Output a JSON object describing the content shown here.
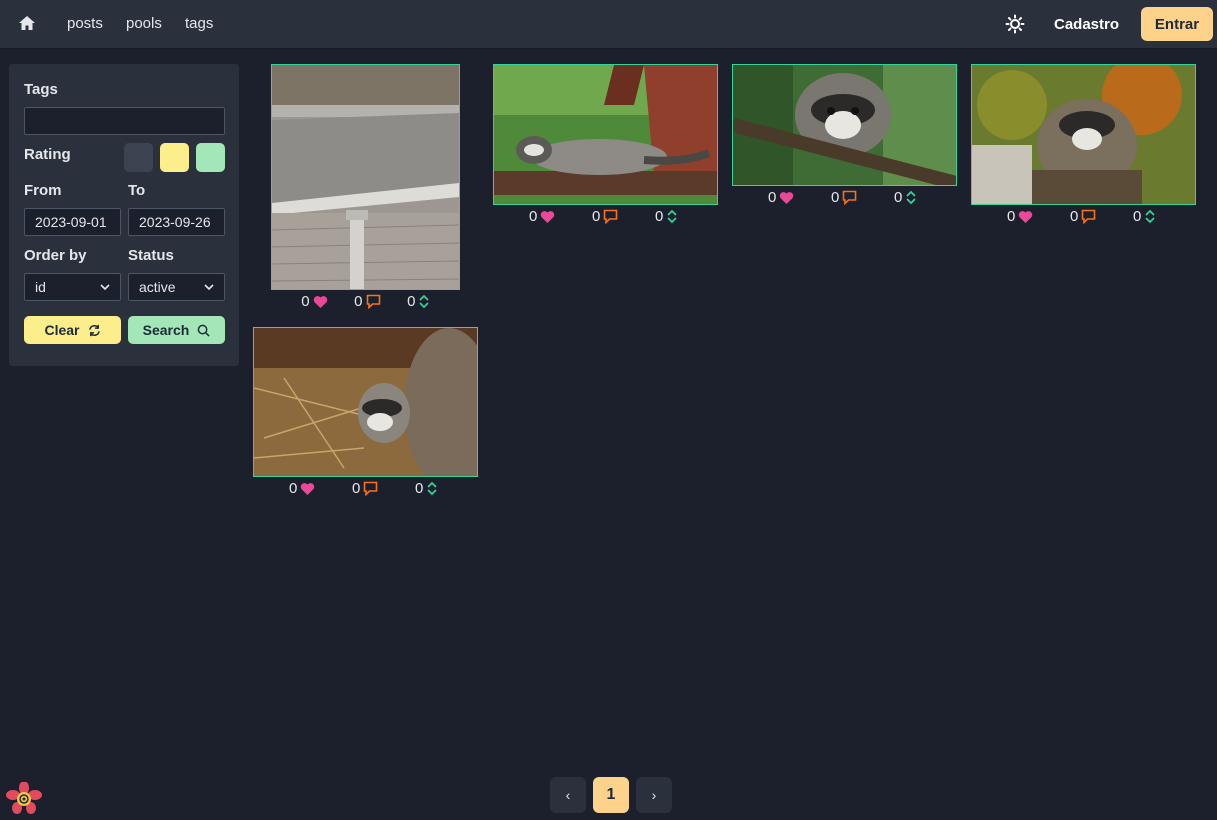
{
  "nav": {
    "home_icon": "home-icon",
    "links": [
      "posts",
      "pools",
      "tags"
    ],
    "theme_icon": "sun-icon",
    "signup_label": "Cadastro",
    "login_label": "Entrar"
  },
  "filters": {
    "tags_label": "Tags",
    "tags_value": "",
    "rating_label": "Rating",
    "rating_colors": [
      "#3d4451",
      "#fcef8b",
      "#a3e7b8"
    ],
    "from_label": "From",
    "to_label": "To",
    "from_value": "2023-09-01",
    "to_value": "2023-09-26",
    "order_label": "Order by",
    "order_value": "id",
    "status_label": "Status",
    "status_value": "active",
    "clear_label": "Clear",
    "clear_icon": "refresh-icon",
    "search_label": "Search",
    "search_icon": "search-icon"
  },
  "posts": [
    {
      "likes": "0",
      "comments": "0",
      "score": "0"
    },
    {
      "likes": "0",
      "comments": "0",
      "score": "0"
    },
    {
      "likes": "0",
      "comments": "0",
      "score": "0"
    },
    {
      "likes": "0",
      "comments": "0",
      "score": "0"
    },
    {
      "likes": "0",
      "comments": "0",
      "score": "0"
    }
  ],
  "pagination": {
    "prev": "‹",
    "current": "1",
    "next": "›"
  },
  "colors": {
    "accent": "#fdd28b",
    "like": "#ec4899",
    "comment": "#f97316",
    "score": "#36d399",
    "border": "#36d399"
  }
}
